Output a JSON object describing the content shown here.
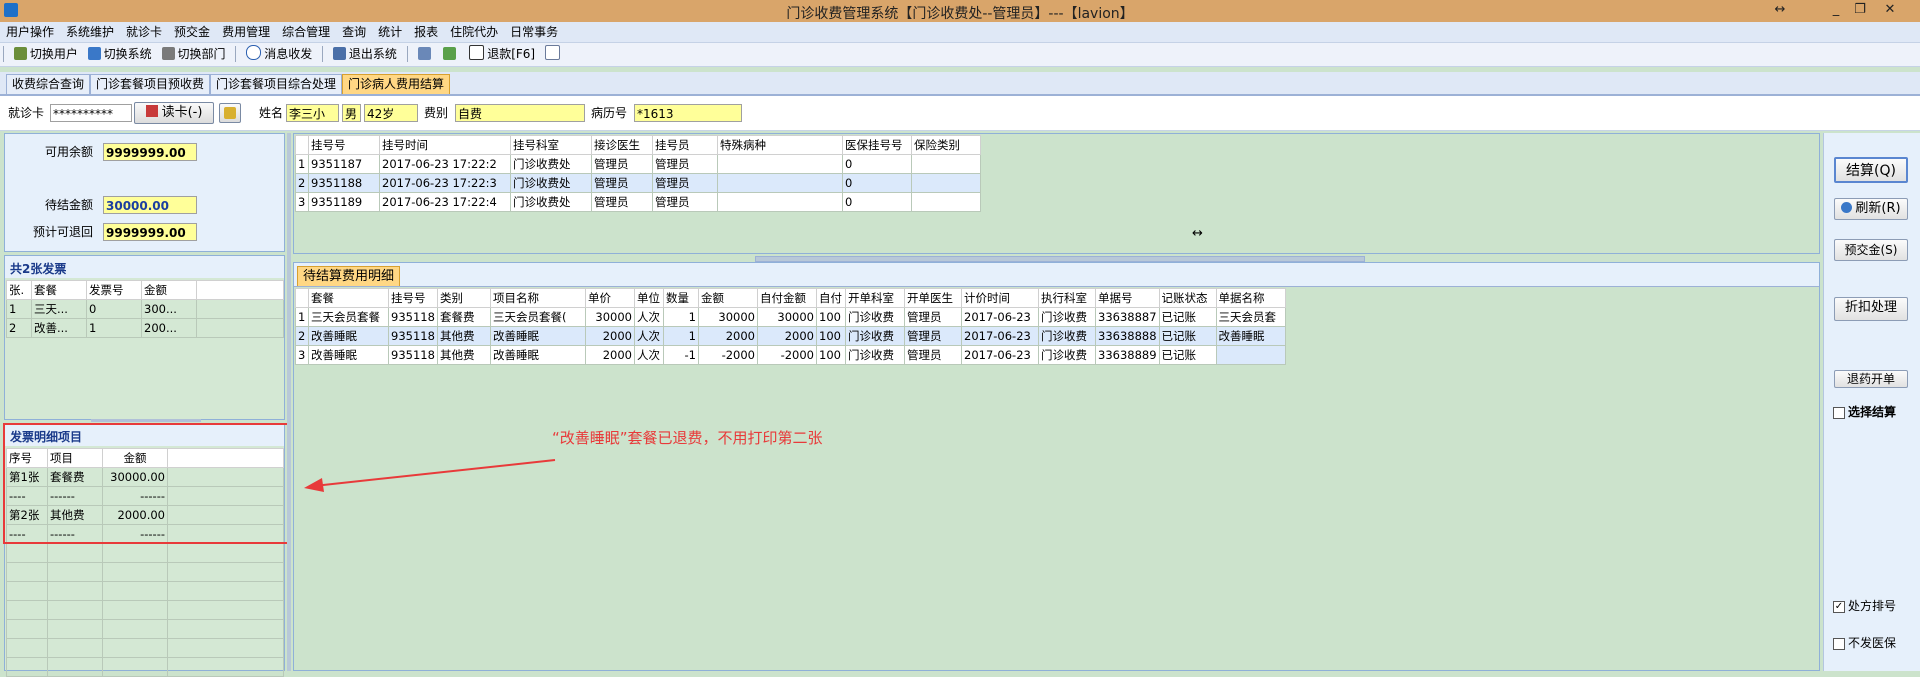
{
  "window": {
    "title": "门诊收费管理系统【门诊收费处--管理员】---【lavion】",
    "restore_glyph": "↔",
    "min_glyph": "_",
    "max_glyph": "❐",
    "close_glyph": "✕"
  },
  "menu": [
    "用户操作",
    "系统维护",
    "就诊卡",
    "预交金",
    "费用管理",
    "综合管理",
    "查询",
    "统计",
    "报表",
    "住院代办",
    "日常事务"
  ],
  "toolbar": {
    "switch_user": "切换用户",
    "switch_system": "切换系统",
    "switch_dept": "切换部门",
    "message": "消息收发",
    "exit": "退出系统",
    "refund": "退款[F6]"
  },
  "tabs": [
    "收费综合查询",
    "门诊套餐项目预收费",
    "门诊套餐项目综合处理",
    "门诊病人费用结算"
  ],
  "patient": {
    "card_label": "就诊卡",
    "card_value": "**********",
    "read_card": "读卡(-)",
    "name_label": "姓名",
    "name": "李三小",
    "sex": "男",
    "age": "42岁",
    "fee_type_label": "费别",
    "fee_type": "自费",
    "record_label": "病历号",
    "record_no": "*1613"
  },
  "balance": {
    "available_label": "可用余额",
    "available": "9999999.00",
    "pending_label": "待结金额",
    "pending": "30000.00",
    "refundable_label": "预计可退回",
    "refundable": "9999999.00"
  },
  "invoices": {
    "title": "共2张发票",
    "headers": [
      "张.",
      "套餐",
      "发票号",
      "金额"
    ],
    "rows": [
      [
        "1",
        "三天...",
        "0",
        "300..."
      ],
      [
        "2",
        "改善...",
        "1",
        "200..."
      ]
    ]
  },
  "invoice_detail": {
    "title": "发票明细项目",
    "headers": [
      "序号",
      "项目",
      "金额"
    ],
    "rows": [
      [
        "第1张",
        "套餐费",
        "30000.00"
      ],
      [
        "----",
        "------",
        "------"
      ],
      [
        "第2张",
        "其他费",
        "2000.00"
      ],
      [
        "----",
        "------",
        "------"
      ]
    ]
  },
  "registration": {
    "headers": [
      "",
      "挂号号",
      "挂号时间",
      "挂号科室",
      "接诊医生",
      "挂号员",
      "特殊病种",
      "医保挂号号",
      "保险类别"
    ],
    "rows": [
      [
        "1",
        "9351187",
        "2017-06-23 17:22:2",
        "门诊收费处",
        "管理员",
        "管理员",
        "",
        "0",
        ""
      ],
      [
        "2",
        "9351188",
        "2017-06-23 17:22:3",
        "门诊收费处",
        "管理员",
        "管理员",
        "",
        "0",
        ""
      ],
      [
        "3",
        "9351189",
        "2017-06-23 17:22:4",
        "门诊收费处",
        "管理员",
        "管理员",
        "",
        "0",
        ""
      ]
    ],
    "splitter_glyph": "↔"
  },
  "pending_tab": "待结算费用明细",
  "details": {
    "headers": [
      "",
      "套餐",
      "挂号号",
      "类别",
      "项目名称",
      "单价",
      "单位",
      "数量",
      "金额",
      "自付金额",
      "自付",
      "开单科室",
      "开单医生",
      "计价时间",
      "执行科室",
      "单据号",
      "记账状态",
      "单据名称"
    ],
    "rows": [
      [
        "1",
        "三天会员套餐",
        "935118",
        "套餐费",
        "三天会员套餐(",
        "30000",
        "人次",
        "1",
        "30000",
        "30000",
        "100",
        "门诊收费",
        "管理员",
        "2017-06-23",
        "门诊收费",
        "33638887",
        "已记账",
        "三天会员套"
      ],
      [
        "2",
        "改善睡眠",
        "935118",
        "其他费",
        "改善睡眠",
        "2000",
        "人次",
        "1",
        "2000",
        "2000",
        "100",
        "门诊收费",
        "管理员",
        "2017-06-23",
        "门诊收费",
        "33638888",
        "已记账",
        "改善睡眠"
      ],
      [
        "3",
        "改善睡眠",
        "935118",
        "其他费",
        "改善睡眠",
        "2000",
        "人次",
        "-1",
        "-2000",
        "-2000",
        "100",
        "门诊收费",
        "管理员",
        "2017-06-23",
        "门诊收费",
        "33638889",
        "已记账",
        ""
      ]
    ]
  },
  "annotation": "“改善睡眠”套餐已退费，不用打印第二张",
  "right": {
    "settle": "结算(Q)",
    "refresh": "刷新(R)",
    "prepay": "预交金(S)",
    "discount": "折扣处理",
    "refund_order": "退药开单",
    "select_settle": "选择结算",
    "rx_queue": "处方排号",
    "no_insurance": "不发医保"
  },
  "colors": {
    "annotation": "#e83a3a",
    "yellow_field": "#ffff99",
    "panel": "#d4e8d4"
  }
}
